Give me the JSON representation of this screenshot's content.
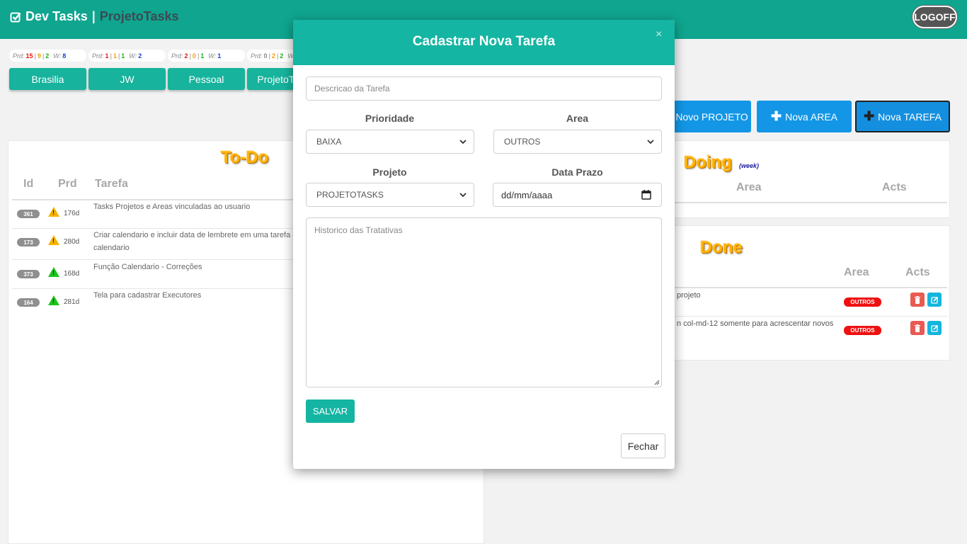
{
  "header": {
    "app_name": "Dev Tasks",
    "separator": "|",
    "project_name": "ProjetoTasks",
    "logoff_label": "LOGOFF"
  },
  "projects": [
    {
      "label": "Brasilia",
      "prd_label": "Prd:",
      "p1": "15",
      "p2": "9",
      "p3": "2",
      "w_label": "W:",
      "w": "8"
    },
    {
      "label": "JW",
      "prd_label": "Prd:",
      "p1": "1",
      "p2": "1",
      "p3": "1",
      "w_label": "W:",
      "w": "2"
    },
    {
      "label": "Pessoal",
      "prd_label": "Prd:",
      "p1": "2",
      "p2": "0",
      "p3": "1",
      "w_label": "W:",
      "w": "1"
    },
    {
      "label": "ProjetoTasks",
      "prd_label": "Prd:",
      "p1": "0",
      "p2": "2",
      "p3": "2",
      "w_label": "W",
      "w": ""
    }
  ],
  "actions": {
    "novo_projeto": "Novo PROJETO",
    "nova_area": "Nova AREA",
    "nova_tarefa": "Nova TAREFA"
  },
  "todo": {
    "title": "To-Do",
    "columns": {
      "id": "Id",
      "prd": "Prd",
      "tarefa": "Tarefa"
    },
    "rows": [
      {
        "id": "361",
        "days": "176d",
        "priority_icon": "warning-yellow",
        "task": "Tasks Projetos e Areas vinculadas ao usuario"
      },
      {
        "id": "173",
        "days": "280d",
        "priority_icon": "warning-yellow",
        "task": "Criar calendario e incluir data de lembrete em uma tarefa e",
        "task_line2": "calendario"
      },
      {
        "id": "373",
        "days": "168d",
        "priority_icon": "warning-green",
        "task": "Função Calendario - Correções"
      },
      {
        "id": "164",
        "days": "281d",
        "priority_icon": "warning-green",
        "task": "Tela para cadastrar Executores"
      }
    ]
  },
  "doing": {
    "title": "Doing",
    "subtitle": "(week)",
    "columns": {
      "area": "Area",
      "acts": "Acts"
    }
  },
  "done": {
    "title": "Done",
    "columns": {
      "area": "Area",
      "acts": "Acts"
    },
    "rows": [
      {
        "text": "projeto",
        "area": "OUTROS"
      },
      {
        "text": "n col-md-12 somente para acrescentar novos",
        "area": "OUTROS"
      }
    ]
  },
  "modal": {
    "title": "Cadastrar Nova Tarefa",
    "close": "×",
    "descricao_placeholder": "Descricao da Tarefa",
    "prioridade_label": "Prioridade",
    "prioridade_value": "BAIXA",
    "area_label": "Area",
    "area_value": "OUTROS",
    "projeto_label": "Projeto",
    "projeto_value": "PROJETOTASKS",
    "data_label": "Data Prazo",
    "data_value": "dd/mm/aaaa",
    "historico_placeholder": "Historico das Tratativas",
    "salvar": "SALVAR",
    "fechar": "Fechar"
  },
  "colors": {
    "header": "#0fa58f",
    "modal_header": "#14b5a2",
    "action_blue": "#1396e6",
    "title_orange": "#ffb300",
    "badge_red": "#ee1111"
  }
}
